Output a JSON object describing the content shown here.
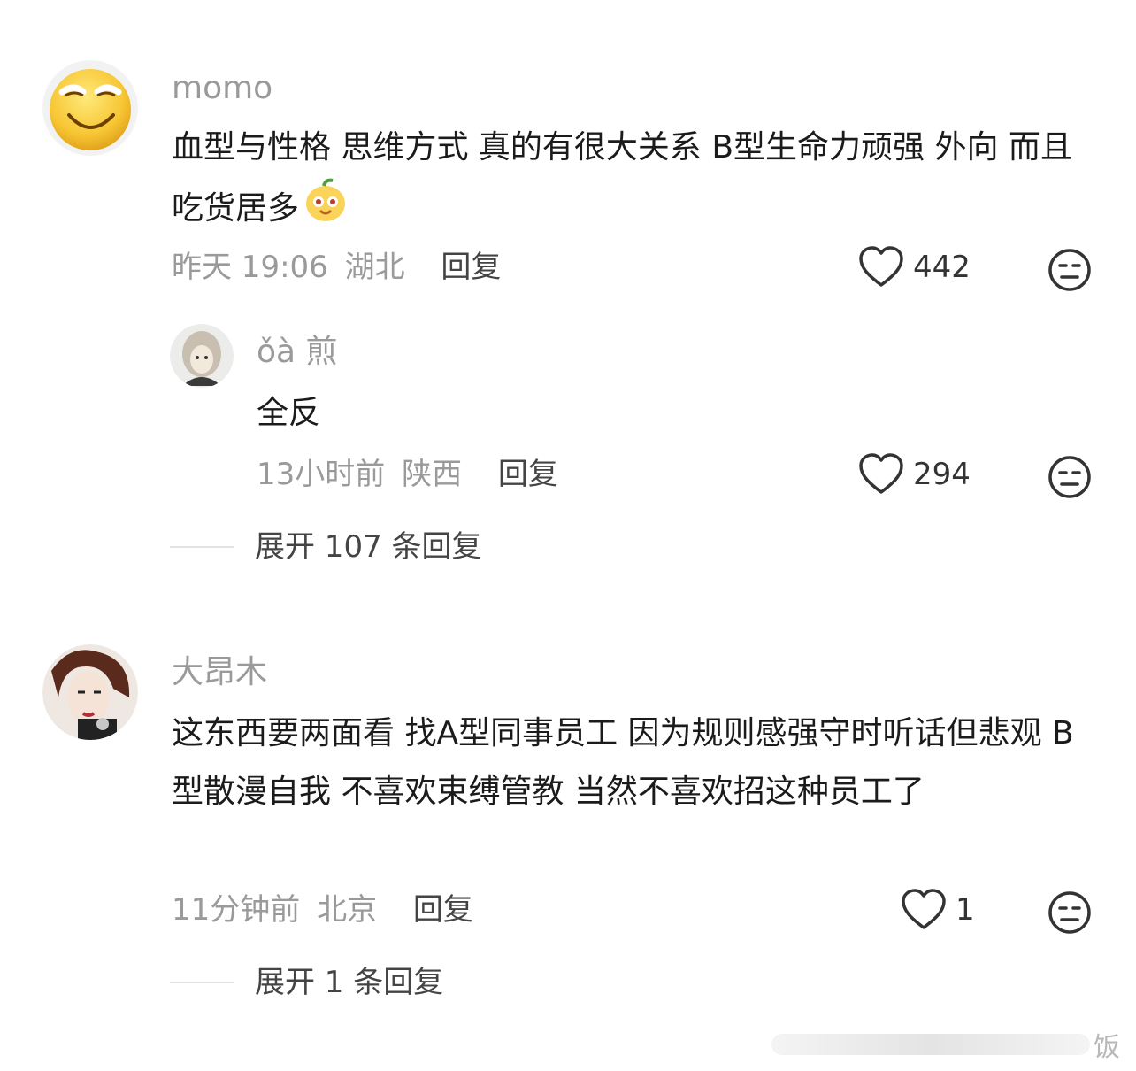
{
  "comments": [
    {
      "username": "momo",
      "content": "血型与性格  思维方式   真的有很大关系    B型生命力顽强   外向     而且吃货居多",
      "time": "昨天 19:06",
      "location": "湖北",
      "reply_label": "回复",
      "likes": "442",
      "avatar_icon": "smiling-face-emoji",
      "inline_emoji": "foodie-emoji",
      "replies": [
        {
          "username": "ǒà 煎",
          "content": "全反",
          "time": "13小时前",
          "location": "陕西",
          "reply_label": "回复",
          "likes": "294"
        }
      ],
      "expand_label": "展开 107 条回复"
    },
    {
      "username": "大昂木",
      "content": "这东西要两面看 找A型同事员工 因为规则感强守时听话但悲观  B型散漫自我 不喜欢束缚管教 当然不喜欢招这种员工了",
      "time": "11分钟前",
      "location": "北京",
      "reply_label": "回复",
      "likes": "1",
      "expand_label": "展开 1 条回复"
    }
  ],
  "icons": {
    "like": "heart-outline-icon",
    "dislike": "meh-face-icon"
  },
  "colors": {
    "username": "#9a9a9a",
    "text": "#1b1b1b",
    "meta": "#9a9a9a"
  },
  "watermark": "饭"
}
